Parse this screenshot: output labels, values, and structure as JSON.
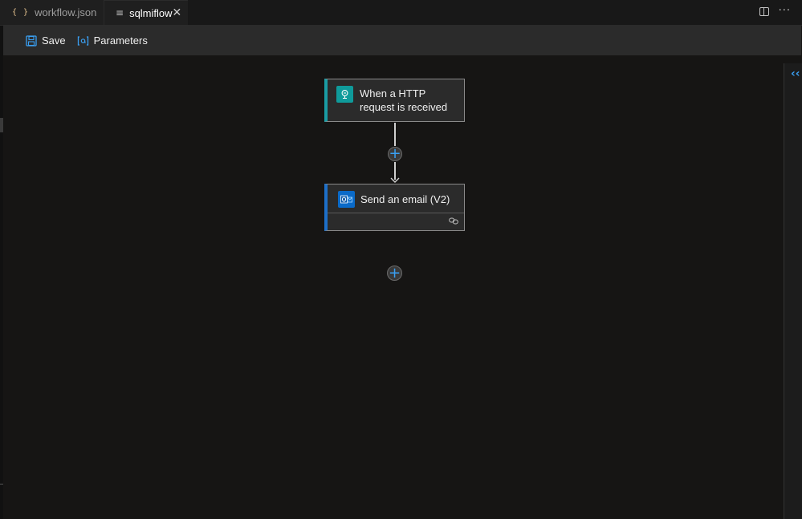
{
  "tabs": [
    {
      "label": "workflow.json",
      "icon": "json-braces-icon",
      "active": false
    },
    {
      "label": "sqlmiflow",
      "icon": "lines-icon",
      "active": true
    }
  ],
  "toolbar": {
    "save_label": "Save",
    "parameters_label": "Parameters"
  },
  "workflow": {
    "trigger": {
      "title": "When a HTTP request is received",
      "icon": "http-request-icon",
      "accent": "#1a9ca4"
    },
    "action": {
      "title": "Send an email (V2)",
      "icon": "outlook-icon",
      "accent": "#1d6fc8"
    }
  },
  "colors": {
    "accent_blue": "#3aa0f3",
    "canvas": "#161514",
    "card": "#2b2b2b"
  }
}
